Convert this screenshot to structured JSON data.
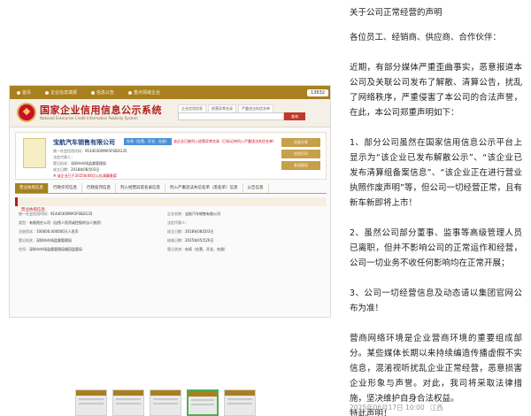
{
  "gsxt": {
    "topnav": [
      "首页",
      "企业信息填报",
      "信息公告",
      "重点领域企业",
      "13632"
    ],
    "title": "国家企业信用信息公示系统",
    "subtitle": "National Enterprise Credit Information Publicity System",
    "search_tabs": [
      "企业信用信息",
      "经营异常名录",
      "严重违法失信名单"
    ],
    "search_button": "查询",
    "company_name": "宝航汽车销售有限公司",
    "status_tag": "存续（在营、开业、在册）",
    "warn_top": "该企业已被列入经营异常名录（已标记待列入严重违法失信名单）",
    "fields": [
      {
        "k": "统一社会信用代码：",
        "v": "91440300MA5F6B2G35"
      },
      {
        "k": "法定代表人：",
        "v": ""
      },
      {
        "k": "登记机关：",
        "v": "深圳市市场监督管理局"
      },
      {
        "k": "成立日期：",
        "v": "2018年08月03日"
      }
    ],
    "warn_bottom": "※ 该企业已于2025年06月公告清算备案",
    "actions": [
      "信息分享",
      "信息打印",
      "发送报告"
    ],
    "tabs": [
      "营业执照信息",
      "行政许可信息",
      "行政处罚信息",
      "列入经营异常名录信息",
      "列入严重违法失信名单（黑名单）信息",
      "公告信息"
    ],
    "section": "营业执照信息",
    "info_left": [
      {
        "k": "统一社会信用代码：",
        "v": "91440300MA5F6B2G35"
      },
      {
        "k": "类型：",
        "v": "有限责任公司（自然人投资或控股的法人独资）"
      },
      {
        "k": "注册资本：",
        "v": "100000.000000万人民币"
      },
      {
        "k": "登记机关：",
        "v": "深圳市市场监督管理局"
      },
      {
        "k": "住所：",
        "v": "深圳市市场监督管理局福田监管局"
      }
    ],
    "info_right": [
      {
        "k": "企业名称：",
        "v": "宝航汽车销售有限公司"
      },
      {
        "k": "法定代表人：",
        "v": ""
      },
      {
        "k": "成立日期：",
        "v": "2018年08月03日"
      },
      {
        "k": "核准日期：",
        "v": "2025年05月26日"
      },
      {
        "k": "登记状态：",
        "v": "存续（在营、开业、在册）"
      }
    ]
  },
  "statement": {
    "title": "关于公司正常经营的声明",
    "greeting": "各位员工、经销商、供应商、合作伙伴：",
    "p1": "近期，有部分媒体严重歪曲事实，恶意报道本公司及关联公司发布了解散、清算公告，扰乱了网络秩序，严重侵害了本公司的合法声誉，在此，本公司郑重声明如下：",
    "p2": "1、部分公司虽然在国家信用信息公示平台上显示为“该企业已发布解散公示”、“该企业已发布清算组备案信息”、“该企业正在进行营业执照作废声明”等，但公司一切经营正常，且有新车新即将上市！",
    "p3": "2、虽然公司部分董事、监事等高级管理人员已离职，但并不影响公司的正常运作和经营，公司一切业务不收任何影响均在正常开展；",
    "p4": "3、公司一切经营信息及动态请以集团官网公布为准！",
    "p5": "营商网络环境是企业营商环境的重要组成部分。某些媒体长期以来持续编造传播虚假不实信息，混淆视听扰乱企业正常经营，恶意损害企业形象与声誉。对此，我司将采取法律措施，坚决维护自身合法权益。",
    "sign": "特此声明！",
    "date": "2025年06月17日 10:00",
    "location": "江西"
  }
}
